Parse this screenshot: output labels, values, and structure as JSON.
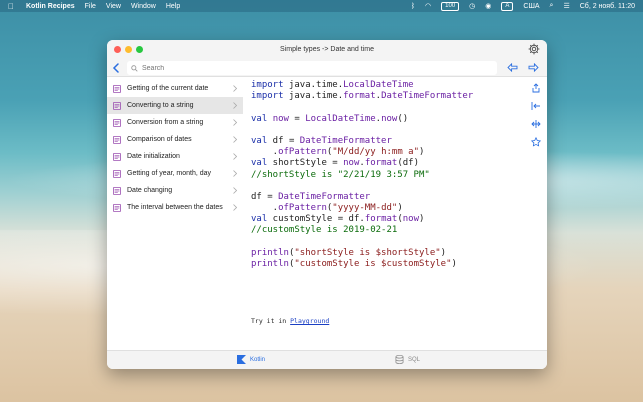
{
  "menubar": {
    "app_name": "Kotlin Recipes",
    "menus": [
      "File",
      "View",
      "Window",
      "Help"
    ],
    "battery_label": "100",
    "input_label": "A",
    "input_region": "США",
    "datetime": "Сб, 2 нояб. 11:20"
  },
  "window": {
    "title": "Simple types -> Date and time"
  },
  "search": {
    "placeholder": "Search"
  },
  "sidebar": {
    "items": [
      {
        "label": "Getting of the current date"
      },
      {
        "label": "Converting to a string"
      },
      {
        "label": "Conversion from a string"
      },
      {
        "label": "Comparison of dates"
      },
      {
        "label": "Date initialization"
      },
      {
        "label": "Getting of year, month, day"
      },
      {
        "label": "Date changing"
      },
      {
        "label": "The interval between the dates"
      }
    ],
    "selected_index": 1
  },
  "code": {
    "lines": [
      "import java.time.LocalDateTime",
      "import java.time.format.DateTimeFormatter",
      "",
      "val now = LocalDateTime.now()",
      "",
      "val df = DateTimeFormatter",
      "    .ofPattern(\"M/dd/yy h:mm a\")",
      "val shortStyle = now.format(df)",
      "//shortStyle is \"2/21/19 3:57 PM\"",
      "",
      "df = DateTimeFormatter",
      "    .ofPattern(\"yyyy-MM-dd\")",
      "val customStyle = df.format(now)",
      "//customStyle is 2019-02-21",
      "",
      "println(\"shortStyle is $shortStyle\")",
      "println(\"customStyle is $customStyle\")"
    ]
  },
  "try_it": {
    "prefix": "Try it in ",
    "link": "Playground"
  },
  "tabs": [
    {
      "label": "Kotlin",
      "active": true
    },
    {
      "label": "SQL",
      "active": false
    }
  ],
  "colors": {
    "accent": "#2a6ee0",
    "sidebar_icon": "#9a4fb0"
  }
}
